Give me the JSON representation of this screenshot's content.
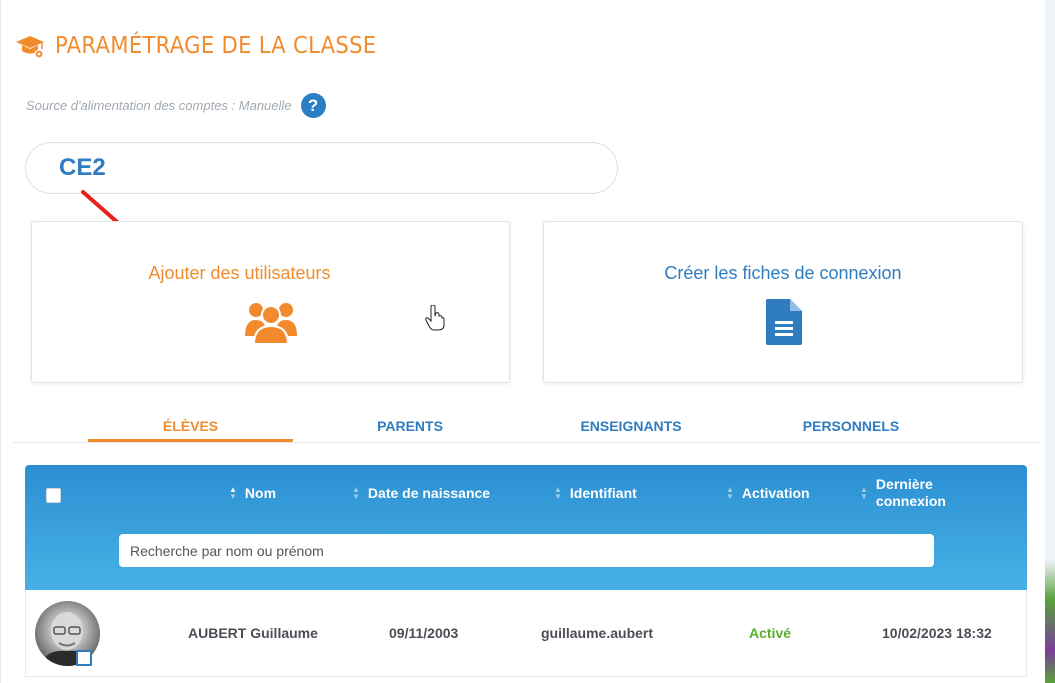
{
  "header": {
    "title": "PARAMÉTRAGE DE LA CLASSE"
  },
  "source": {
    "text": "Source d'alimentation des comptes : Manuelle",
    "help_glyph": "?"
  },
  "class_name": "CE2",
  "actions": {
    "add_users": "Ajouter des utilisateurs",
    "create_sheets": "Créer les fiches de connexion"
  },
  "tabs": [
    {
      "label": "ÉLÈVES",
      "active": true
    },
    {
      "label": "PARENTS",
      "active": false
    },
    {
      "label": "ENSEIGNANTS",
      "active": false
    },
    {
      "label": "PERSONNELS",
      "active": false
    }
  ],
  "table": {
    "columns": {
      "nom": "Nom",
      "date": "Date de naissance",
      "identifiant": "Identifiant",
      "activation": "Activation",
      "derniere_1": "Dernière",
      "derniere_2": "connexion"
    },
    "search_placeholder": "Recherche par nom ou prénom",
    "rows": [
      {
        "name": "AUBERT Guillaume",
        "birth": "09/11/2003",
        "login": "guillaume.aubert",
        "status": "Activé",
        "last_login": "10/02/2023 18:32"
      }
    ]
  },
  "colors": {
    "accent_orange": "#f18b2d",
    "accent_blue": "#2f7cc0",
    "status_green": "#5aae2e"
  }
}
